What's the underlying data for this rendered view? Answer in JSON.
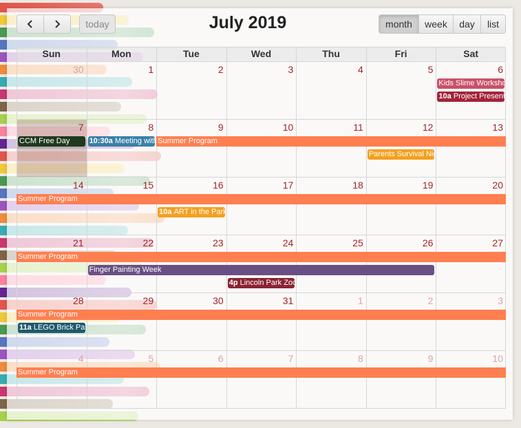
{
  "toolbar": {
    "title": "July 2019",
    "today_label": "today",
    "views": [
      {
        "label": "month",
        "active": true
      },
      {
        "label": "week",
        "active": false
      },
      {
        "label": "day",
        "active": false
      },
      {
        "label": "list",
        "active": false
      }
    ]
  },
  "weekdays": [
    "Sun",
    "Mon",
    "Tue",
    "Wed",
    "Thu",
    "Fri",
    "Sat"
  ],
  "weeks": [
    [
      {
        "n": "30",
        "other": true
      },
      {
        "n": "1"
      },
      {
        "n": "2"
      },
      {
        "n": "3"
      },
      {
        "n": "4"
      },
      {
        "n": "5"
      },
      {
        "n": "6"
      }
    ],
    [
      {
        "n": "7"
      },
      {
        "n": "8"
      },
      {
        "n": "9"
      },
      {
        "n": "10"
      },
      {
        "n": "11"
      },
      {
        "n": "12"
      },
      {
        "n": "13"
      }
    ],
    [
      {
        "n": "14"
      },
      {
        "n": "15"
      },
      {
        "n": "16"
      },
      {
        "n": "17"
      },
      {
        "n": "18"
      },
      {
        "n": "19"
      },
      {
        "n": "20"
      }
    ],
    [
      {
        "n": "21"
      },
      {
        "n": "22"
      },
      {
        "n": "23"
      },
      {
        "n": "24"
      },
      {
        "n": "25"
      },
      {
        "n": "26"
      },
      {
        "n": "27"
      }
    ],
    [
      {
        "n": "28"
      },
      {
        "n": "29"
      },
      {
        "n": "30"
      },
      {
        "n": "31"
      },
      {
        "n": "1",
        "other": true
      },
      {
        "n": "2",
        "other": true
      },
      {
        "n": "3",
        "other": true
      }
    ],
    [
      {
        "n": "4",
        "other": true
      },
      {
        "n": "5",
        "other": true
      },
      {
        "n": "6",
        "other": true
      },
      {
        "n": "7",
        "other": true
      },
      {
        "n": "8",
        "other": true
      },
      {
        "n": "9",
        "other": true
      },
      {
        "n": "10",
        "other": true
      }
    ]
  ],
  "events": [
    {
      "week": 0,
      "col": 6,
      "span": 1,
      "slot": 0,
      "time": "",
      "title": "Kids Slime Workshop",
      "color": "#c9506a"
    },
    {
      "week": 0,
      "col": 6,
      "span": 1,
      "slot": 1,
      "time": "10a",
      "title": "Project Presentation",
      "color": "#a3243a"
    },
    {
      "week": 1,
      "col": 0,
      "span": 1,
      "slot": 0,
      "time": "",
      "title": "CCM Free Day",
      "color": "#1e3a1e"
    },
    {
      "week": 1,
      "col": 1,
      "span": 1,
      "slot": 0,
      "time": "10:30a",
      "title": "Meeting with",
      "color": "#3a7fa8"
    },
    {
      "week": 1,
      "col": 2,
      "span": 5,
      "slot": 0,
      "time": "",
      "title": "Summer Program",
      "color": "#ff7f50",
      "flat": true
    },
    {
      "week": 1,
      "col": 5,
      "span": 1,
      "slot": 1,
      "time": "",
      "title": "Parents Survival Night",
      "color": "#f4a01f"
    },
    {
      "week": 2,
      "col": 0,
      "span": 7,
      "slot": 0,
      "time": "",
      "title": "Summer Program",
      "color": "#ff7f50",
      "flat": true
    },
    {
      "week": 2,
      "col": 2,
      "span": 1,
      "slot": 1,
      "time": "10a",
      "title": "ART in the Park",
      "color": "#f4a01f"
    },
    {
      "week": 3,
      "col": 0,
      "span": 7,
      "slot": 0,
      "time": "",
      "title": "Summer Program",
      "color": "#ff7f50",
      "flat": true
    },
    {
      "week": 3,
      "col": 1,
      "span": 5,
      "slot": 1,
      "time": "",
      "title": "Finger Painting Week",
      "color": "#6a4f85"
    },
    {
      "week": 3,
      "col": 3,
      "span": 1,
      "slot": 2,
      "time": "4p",
      "title": "Lincoln Park Zoo",
      "color": "#8a2433"
    },
    {
      "week": 4,
      "col": 0,
      "span": 7,
      "slot": 0,
      "time": "",
      "title": "Summer Program",
      "color": "#ff7f50",
      "flat": true
    },
    {
      "week": 4,
      "col": 0,
      "span": 1,
      "slot": 1,
      "time": "11a",
      "title": "LEGO Brick Party",
      "color": "#1f5a6e"
    },
    {
      "week": 5,
      "col": 0,
      "span": 7,
      "slot": 0,
      "time": "",
      "title": "Summer Program",
      "color": "#ff7f50",
      "flat": true
    }
  ]
}
